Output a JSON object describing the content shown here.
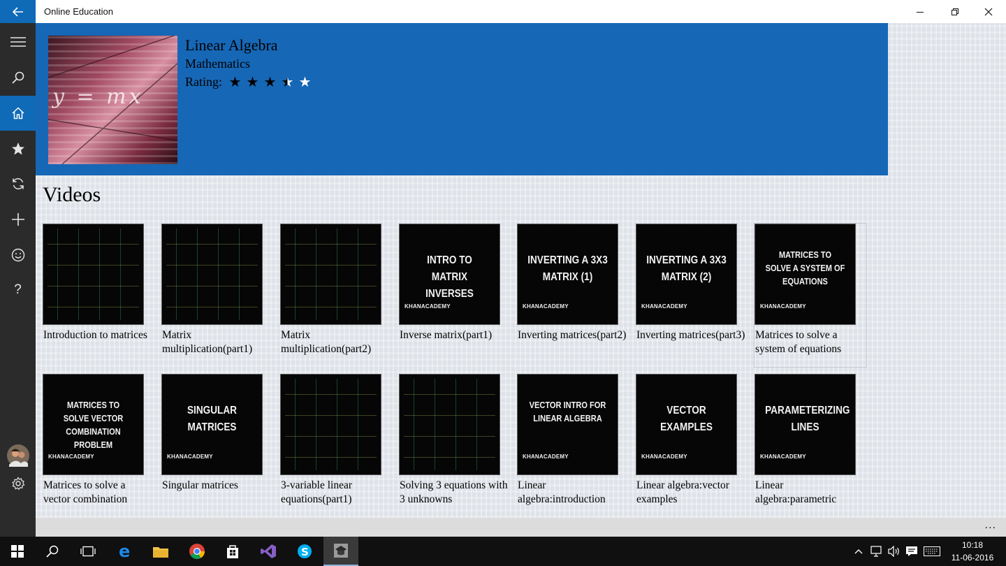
{
  "window": {
    "title": "Online Education"
  },
  "rail": {
    "items": [
      "menu-icon",
      "search-icon",
      "home-icon",
      "star-icon",
      "refresh-icon",
      "add-icon",
      "smiley-icon",
      "help-icon"
    ],
    "active": "home-icon"
  },
  "course": {
    "title": "Linear Algebra",
    "subject": "Mathematics",
    "rating_label": "Rating:",
    "rating": 3.5,
    "rating_max": 5,
    "thumbnail_text": "y = mx"
  },
  "videos_section": {
    "title": "Videos",
    "items": [
      {
        "caption": "Introduction to matrices",
        "headline": "",
        "brand": ""
      },
      {
        "caption": "Matrix multiplication(part1)",
        "headline": "",
        "brand": ""
      },
      {
        "caption": "Matrix multiplication(part2)",
        "headline": "",
        "brand": ""
      },
      {
        "caption": "Inverse matrix(part1)",
        "headline": "INTRO TO MATRIX INVERSES",
        "brand": "KHANACADEMY"
      },
      {
        "caption": "Inverting matrices(part2)",
        "headline": "INVERTING A 3X3 MATRIX (1)",
        "brand": "KHANACADEMY"
      },
      {
        "caption": "Inverting matrices(part3)",
        "headline": "INVERTING A 3X3 MATRIX (2)",
        "brand": "KHANACADEMY"
      },
      {
        "caption": "Matrices to solve a system of equations",
        "headline": "MATRICES TO SOLVE A SYSTEM OF EQUATIONS",
        "brand": "KHANACADEMY"
      },
      {
        "caption": "Matrices to solve a vector combination",
        "headline": "MATRICES TO SOLVE VECTOR COMBINATION PROBLEM",
        "brand": "KHANACADEMY"
      },
      {
        "caption": "Singular matrices",
        "headline": "SINGULAR MATRICES",
        "brand": "KHANACADEMY"
      },
      {
        "caption": "3-variable linear equations(part1)",
        "headline": "",
        "brand": ""
      },
      {
        "caption": "Solving 3 equations with 3 unknowns",
        "headline": "",
        "brand": ""
      },
      {
        "caption": "Linear algebra:introduction",
        "headline": "VECTOR INTRO FOR LINEAR ALGEBRA",
        "brand": "KHANACADEMY"
      },
      {
        "caption": "Linear algebra:vector examples",
        "headline": "VECTOR EXAMPLES",
        "brand": "KHANACADEMY"
      },
      {
        "caption": "Linear algebra:parametric",
        "headline": "PARAMETERIZING LINES",
        "brand": "KHANACADEMY"
      }
    ]
  },
  "appbar": {
    "more": "..."
  },
  "taskbar": {
    "apps": [
      "windows-start-icon",
      "search-icon",
      "task-view-icon",
      "edge-icon",
      "file-explorer-icon",
      "chrome-icon",
      "store-icon",
      "visual-studio-icon",
      "skype-icon",
      "online-education-app-icon"
    ],
    "active_app": "online-education-app-icon",
    "time": "10:18",
    "date": "11-06-2016"
  },
  "colors": {
    "accent": "#1667b6",
    "rail": "#2b2b2b",
    "taskbar": "#101010"
  }
}
